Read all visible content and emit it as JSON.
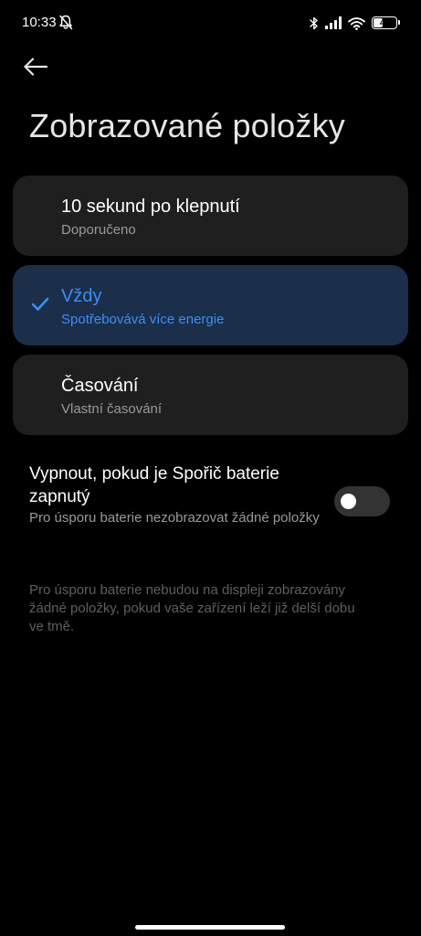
{
  "status_bar": {
    "time": "10:33",
    "battery_level": "46",
    "icons": [
      "bell-off-icon",
      "bluetooth-icon",
      "signal-icon",
      "wifi-icon",
      "battery-icon"
    ]
  },
  "header": {
    "back_icon": "arrow-left-icon",
    "title": "Zobrazované položky"
  },
  "options": [
    {
      "title": "10 sekund po klepnutí",
      "subtitle": "Doporučeno",
      "selected": false
    },
    {
      "title": "Vždy",
      "subtitle": "Spotřebovává více energie",
      "selected": true
    },
    {
      "title": "Časování",
      "subtitle": "Vlastní časování",
      "selected": false
    }
  ],
  "battery_saver_toggle": {
    "title": "Vypnout, pokud je Spořič baterie zapnutý",
    "subtitle": "Pro úsporu baterie nezobrazovat žádné položky",
    "enabled": false
  },
  "footnote": "Pro úsporu baterie nebudou na displeji zobrazovány žádné položky, pokud vaše zařízení leží již delší dobu ve tmě.",
  "colors": {
    "background": "#000000",
    "card": "#1f1f1f",
    "card_selected": "#1b2e4a",
    "accent": "#3d8ef5",
    "secondary_text": "#9a9a9a",
    "footnote_text": "#5f5f5f",
    "toggle_track_off": "#333333"
  }
}
